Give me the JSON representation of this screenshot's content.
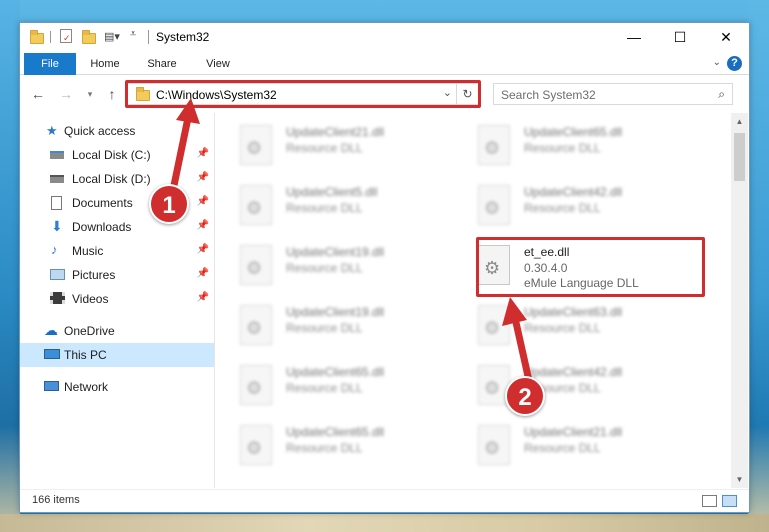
{
  "window": {
    "title": "System32",
    "controls": {
      "minimize": "—",
      "maximize": "☐",
      "close": "✕"
    }
  },
  "ribbon": {
    "tabs": [
      {
        "label": "File"
      },
      {
        "label": "Home"
      },
      {
        "label": "Share"
      },
      {
        "label": "View"
      }
    ],
    "help": "?"
  },
  "address": {
    "path": "C:\\Windows\\System32",
    "search_placeholder": "Search System32"
  },
  "sidebar": {
    "items": [
      {
        "label": "Quick access",
        "icon": "star-icon"
      },
      {
        "label": "Local Disk (C:)",
        "icon": "drive-icon"
      },
      {
        "label": "Local Disk (D:)",
        "icon": "drive-icon"
      },
      {
        "label": "Documents",
        "icon": "documents-icon"
      },
      {
        "label": "Downloads",
        "icon": "downloads-icon"
      },
      {
        "label": "Music",
        "icon": "music-icon"
      },
      {
        "label": "Pictures",
        "icon": "pictures-icon"
      },
      {
        "label": "Videos",
        "icon": "videos-icon"
      },
      {
        "label": "OneDrive",
        "icon": "cloud-icon"
      },
      {
        "label": "This PC",
        "icon": "computer-icon"
      },
      {
        "label": "Network",
        "icon": "network-icon"
      }
    ]
  },
  "files": [
    {
      "name": "UpdateClient21.dll",
      "type": "Resource DLL"
    },
    {
      "name": "UpdateClient65.dll",
      "type": "Resource DLL"
    },
    {
      "name": "UpdateClient5.dll",
      "type": "Resource DLL"
    },
    {
      "name": "UpdateClient42.dll",
      "type": "Resource DLL"
    },
    {
      "name": "UpdateClient19.dll",
      "type": "Resource DLL"
    },
    {
      "name": "et_ee.dll",
      "version": "0.30.4.0",
      "type": "eMule Language DLL"
    },
    {
      "name": "UpdateClient19.dll",
      "type": "Resource DLL"
    },
    {
      "name": "UpdateClient63.dll",
      "type": "Resource DLL"
    },
    {
      "name": "UpdateClient65.dll",
      "type": "Resource DLL"
    },
    {
      "name": "UpdateClient42.dll",
      "type": "Resource DLL"
    },
    {
      "name": "UpdateClient65.dll",
      "type": "Resource DLL"
    },
    {
      "name": "UpdateClient21.dll",
      "type": "Resource DLL"
    }
  ],
  "status": {
    "item_count": "166 items"
  },
  "annotations": {
    "step1": "1",
    "step2": "2"
  },
  "colors": {
    "accent": "#1979ca",
    "highlight": "#d12d2e",
    "selected": "#cce8ff"
  }
}
